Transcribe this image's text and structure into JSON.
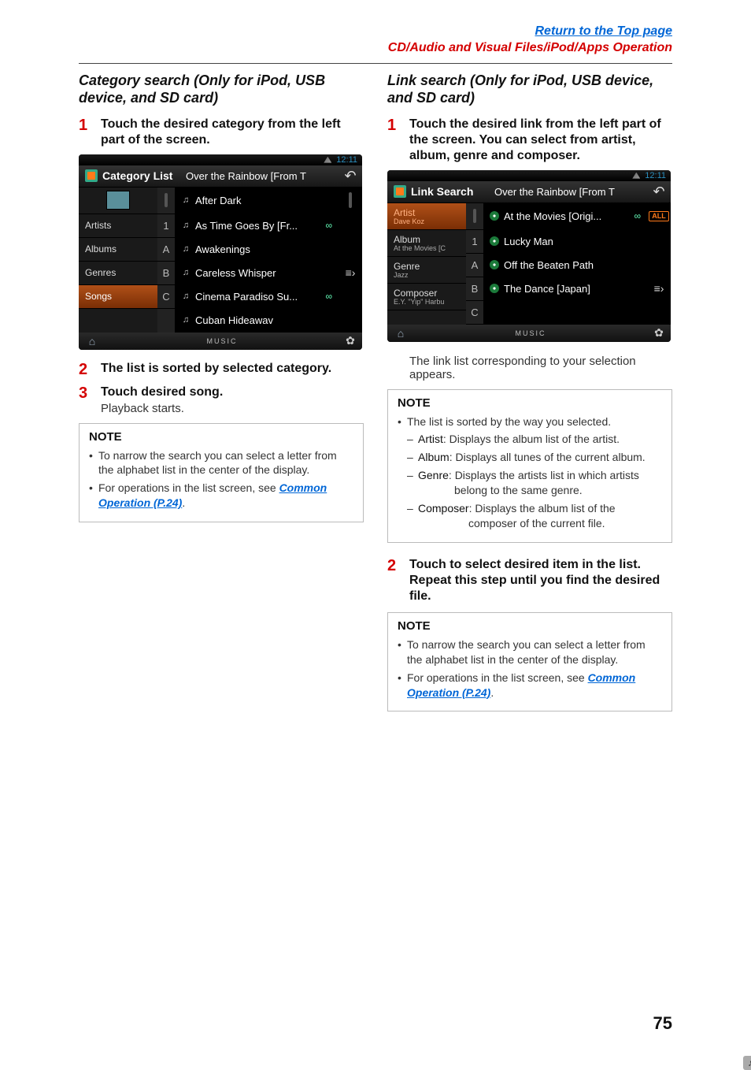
{
  "header": {
    "link_top": "Return to the Top page",
    "breadcrumb": "CD/Audio and Visual Files/iPod/Apps Operation"
  },
  "left": {
    "heading": "Category search (Only for iPod, USB device, and SD card)",
    "steps": {
      "s1": "Touch the desired category from the left part of the screen.",
      "s2": "The list is sorted by selected category.",
      "s3_title": "Touch desired song.",
      "s3_body": "Playback starts."
    },
    "shot": {
      "time": "12:11",
      "title": "Category List",
      "now_playing": "Over the Rainbow [From T",
      "side": [
        "Artists",
        "Albums",
        "Genres",
        "Songs"
      ],
      "alpha": [
        "1",
        "A",
        "B",
        "C"
      ],
      "tracks": [
        {
          "t": "After Dark",
          "trail": ""
        },
        {
          "t": "As Time Goes By [Fr...",
          "trail": "∞"
        },
        {
          "t": "Awakenings",
          "trail": ""
        },
        {
          "t": "Careless Whisper",
          "trail": ""
        },
        {
          "t": "Cinema Paradiso Su...",
          "trail": "∞"
        },
        {
          "t": "Cuban Hideawav",
          "trail": ""
        }
      ],
      "footer_label": "MUSIC"
    },
    "note": {
      "title": "NOTE",
      "li1": "To narrow the search you can select a letter from the alphabet list in the center of the display.",
      "li2_pre": "For operations in the list screen, see ",
      "li2_link": "Common Operation (P.24)",
      "li2_post": "."
    }
  },
  "right": {
    "heading": "Link search (Only for iPod, USB device, and SD card)",
    "steps": {
      "s1": "Touch the desired link from the left part of the screen. You can select from artist, album, genre and composer.",
      "s1_body": "The link list corresponding to your selection appears.",
      "s2": "Touch to select desired item in the list. Repeat this step until you find the desired file."
    },
    "shot": {
      "time": "12:11",
      "title": "Link Search",
      "now_playing": "Over the Rainbow [From T",
      "side": [
        {
          "k": "Artist",
          "v": "Dave Koz",
          "sel": true
        },
        {
          "k": "Album",
          "v": "At the Movies [C",
          "sel": false
        },
        {
          "k": "Genre",
          "v": "Jazz",
          "sel": false
        },
        {
          "k": "Composer",
          "v": "E.Y. \"Yip\" Harbu",
          "sel": false
        }
      ],
      "alpha": [
        "1",
        "A",
        "B",
        "C"
      ],
      "tracks": [
        {
          "t": "At the Movies [Origi...",
          "trail": "∞"
        },
        {
          "t": "Lucky Man",
          "trail": ""
        },
        {
          "t": "Off the Beaten Path",
          "trail": ""
        },
        {
          "t": "The Dance [Japan]",
          "trail": ""
        }
      ],
      "footer_label": "MUSIC",
      "all_label": "ALL"
    },
    "note1": {
      "title": "NOTE",
      "intro": "The list is sorted by the way you selected.",
      "artist_lbl": "Artist",
      "artist_txt": ": Displays the album list of the artist.",
      "album_lbl": "Album",
      "album_txt": ": Displays all tunes of the current album.",
      "genre_lbl": "Genre",
      "genre_txt": ": Displays the artists list in which artists",
      "genre_txt2": "belong to the same genre.",
      "composer_lbl": "Composer",
      "composer_txt": ": Displays the album list of the",
      "composer_txt2": "composer of the current file."
    },
    "note2": {
      "title": "NOTE",
      "li1": "To narrow the search you can select a letter from the alphabet list in the center of the display.",
      "li2_pre": "For operations in the list screen, see ",
      "li2_link": "Common Operation (P.24)",
      "li2_post": "."
    }
  },
  "page_number": "75"
}
